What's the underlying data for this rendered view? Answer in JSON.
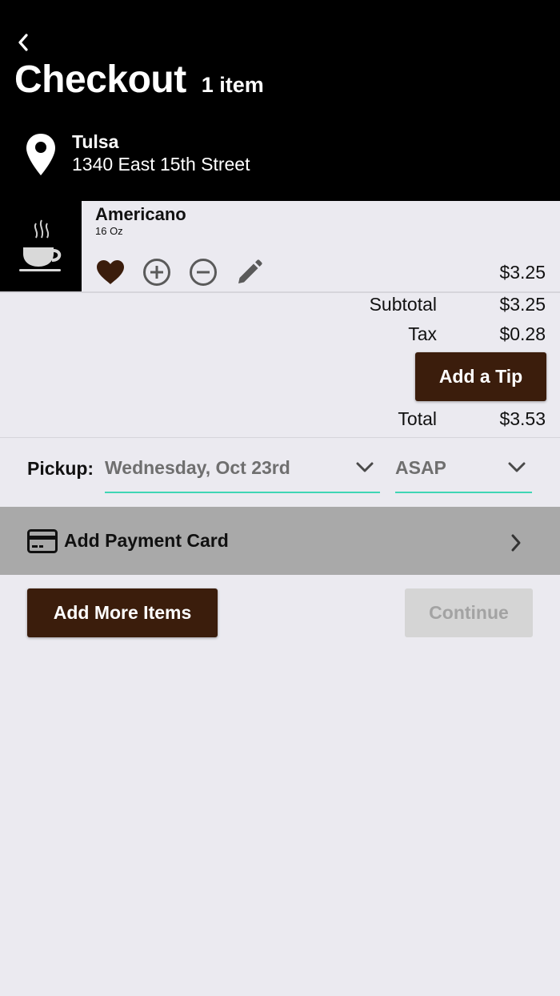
{
  "header": {
    "title": "Checkout",
    "item_count": "1 item",
    "store_name": "Tulsa",
    "store_address": "1340 East 15th Street",
    "back_icon": "chevron-left-icon",
    "location_icon": "map-pin-icon"
  },
  "cart_item": {
    "name": "Americano",
    "size": "16 Oz",
    "price": "$3.25",
    "thumbnail_icon": "coffee-cup-icon",
    "actions": [
      "heart-icon",
      "plus-circle-icon",
      "minus-circle-icon",
      "pencil-icon"
    ]
  },
  "summary": {
    "subtotal_label": "Subtotal",
    "subtotal_value": "$3.25",
    "tax_label": "Tax",
    "tax_value": "$0.28",
    "tip_button": "Add a Tip",
    "total_label": "Total",
    "total_value": "$3.53"
  },
  "pickup": {
    "label": "Pickup:",
    "date": "Wednesday, Oct 23rd",
    "time": "ASAP"
  },
  "payment": {
    "label": "Add Payment Card",
    "icon": "credit-card-icon"
  },
  "buttons": {
    "add_more": "Add More Items",
    "continue": "Continue"
  },
  "colors": {
    "header_bg": "#000000",
    "brand_brown": "#3b1d0c",
    "page_bg": "#ebeaf0",
    "underline_accent": "#3fd6b5",
    "payment_bar_bg": "#a9a9a9",
    "disabled_bg": "#d5d5d5"
  }
}
